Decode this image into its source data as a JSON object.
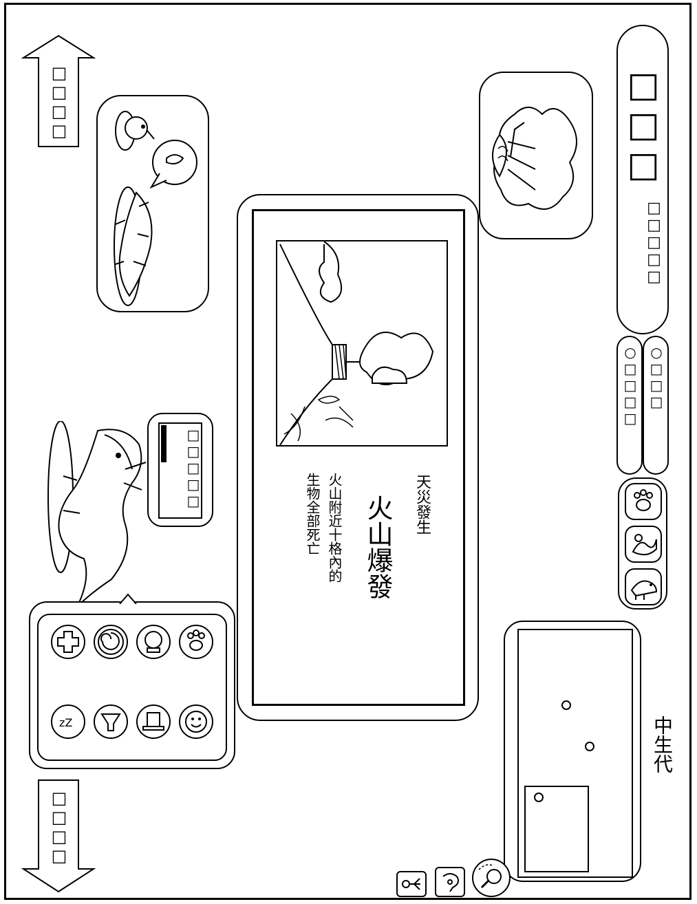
{
  "eraLabel": "中生代",
  "disaster": {
    "header": "天災發生",
    "title": "火山爆發",
    "line1": "火山附近十格內的",
    "line2": "生物全部死亡"
  },
  "scrollUp": {
    "label": "□□□□"
  },
  "scrollDown": {
    "label": "□□□□"
  },
  "topRightPanel": {
    "label": "□□□",
    "sub": "□□□□□"
  },
  "statusBars": [
    {
      "label": "○□□□"
    },
    {
      "label": "○□□□□"
    }
  ],
  "creatureMenu": {
    "label": "□□□□□"
  },
  "actionIcons": [
    "medical-cross-icon",
    "swirl-icon",
    "mirror-icon",
    "paw-icon",
    "sleep-zzz-icon",
    "funnel-icon",
    "top-hat-icon",
    "smile-icon"
  ],
  "categoryIcons": [
    "paw-icon",
    "creature-icon",
    "dinosaur-icon"
  ],
  "bottomTools": [
    "person-icon",
    "hook-icon",
    "magnifier-icon"
  ],
  "colors": {
    "line": "#000000",
    "fill": "#ffffff"
  }
}
